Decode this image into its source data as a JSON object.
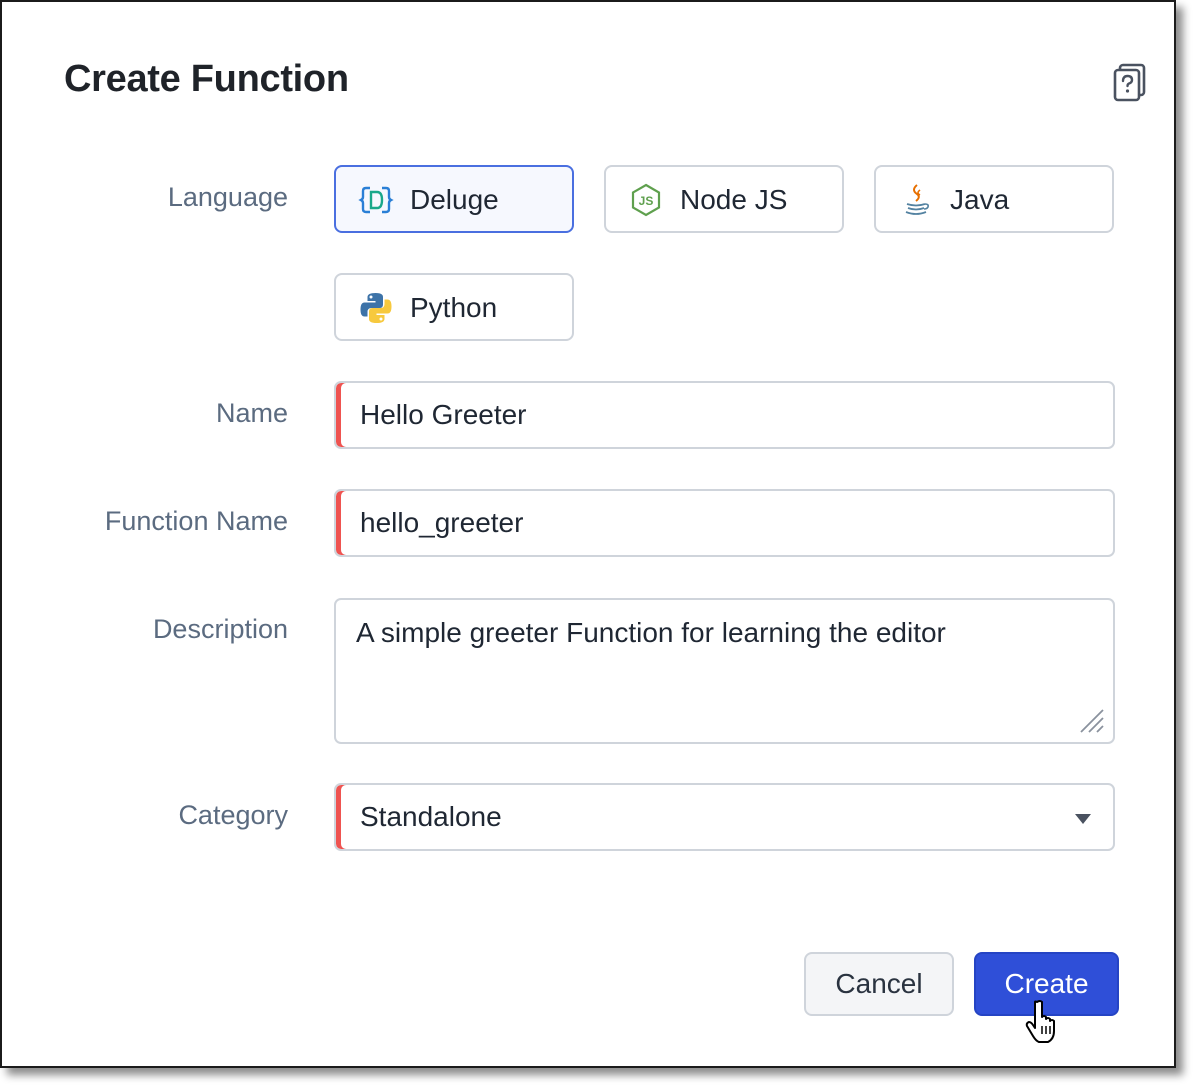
{
  "dialog": {
    "title": "Create Function",
    "help_icon": "help-book-icon"
  },
  "language": {
    "label": "Language",
    "selected": "Deluge",
    "options": [
      {
        "label": "Deluge",
        "icon": "deluge-icon"
      },
      {
        "label": "Node JS",
        "icon": "nodejs-icon"
      },
      {
        "label": "Java",
        "icon": "java-icon"
      },
      {
        "label": "Python",
        "icon": "python-icon"
      }
    ]
  },
  "name": {
    "label": "Name",
    "value": "Hello Greeter"
  },
  "function_name": {
    "label": "Function Name",
    "value": "hello_greeter"
  },
  "description": {
    "label": "Description",
    "value": "A simple greeter Function for learning the editor"
  },
  "category": {
    "label": "Category",
    "value": "Standalone"
  },
  "actions": {
    "cancel": "Cancel",
    "create": "Create"
  },
  "colors": {
    "accent": "#2f4fd8",
    "selected_border": "#4a6fe0",
    "required_marker": "#ef5350"
  }
}
